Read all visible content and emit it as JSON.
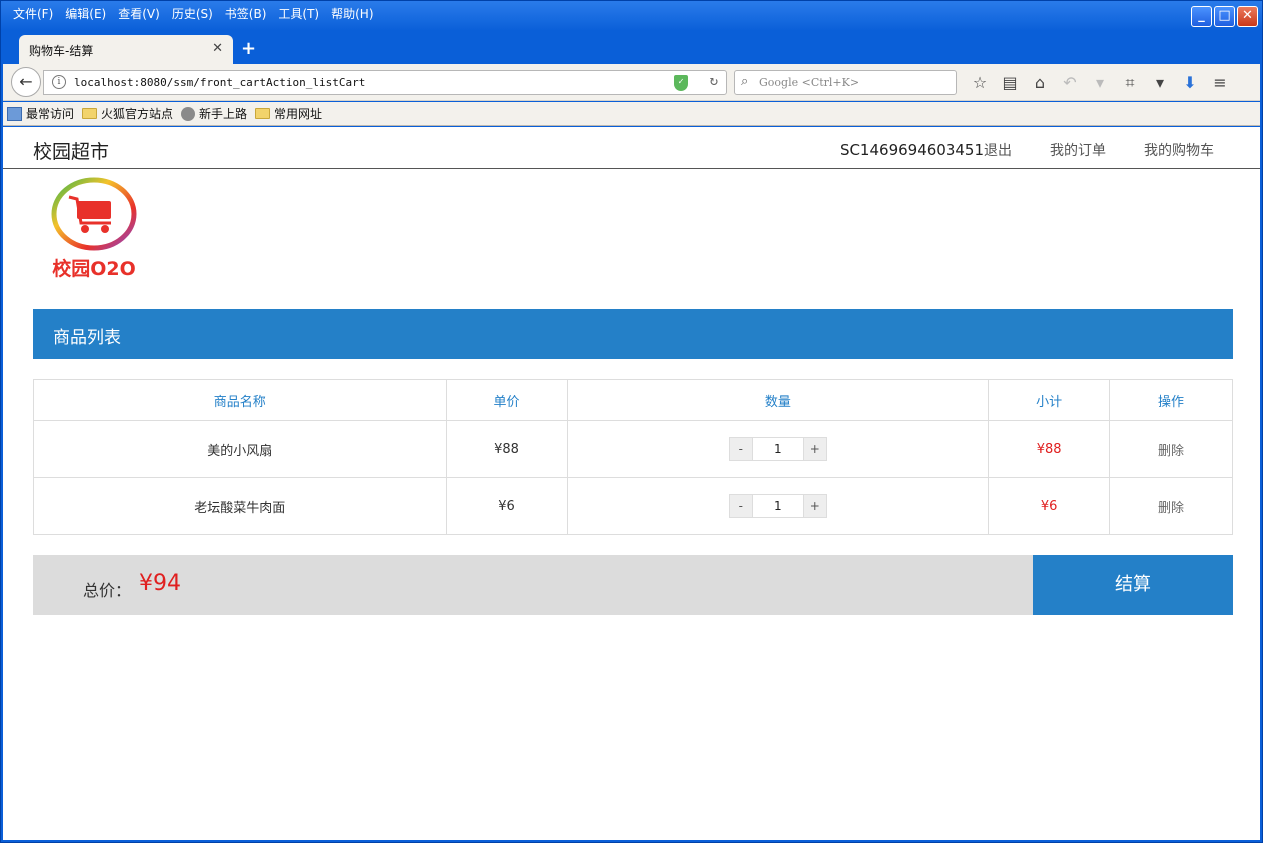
{
  "browser": {
    "menu": [
      "文件(F)",
      "编辑(E)",
      "查看(V)",
      "历史(S)",
      "书签(B)",
      "工具(T)",
      "帮助(H)"
    ],
    "tab_title": "购物车-结算",
    "url": "localhost:8080/ssm/front_cartAction_listCart",
    "search_placeholder": "Google <Ctrl+K>",
    "bookmarks": [
      "最常访问",
      "火狐官方站点",
      "新手上路",
      "常用网址"
    ]
  },
  "site": {
    "brand": "校园超市",
    "user": "SC1469694603451",
    "logout": "退出",
    "my_orders": "我的订单",
    "my_cart": "我的购物车",
    "logo_text": "校园O2O"
  },
  "cart": {
    "section_title": "商品列表",
    "columns": [
      "商品名称",
      "单价",
      "数量",
      "小计",
      "操作"
    ],
    "rows": [
      {
        "name": "美的小风扇",
        "price": "¥88",
        "qty": "1",
        "subtotal": "¥88",
        "action": "删除"
      },
      {
        "name": "老坛酸菜牛肉面",
        "price": "¥6",
        "qty": "1",
        "subtotal": "¥6",
        "action": "删除"
      }
    ],
    "minus": "-",
    "plus": "+",
    "total_label": "总价：",
    "total_value": "¥94",
    "checkout_label": "结算"
  }
}
